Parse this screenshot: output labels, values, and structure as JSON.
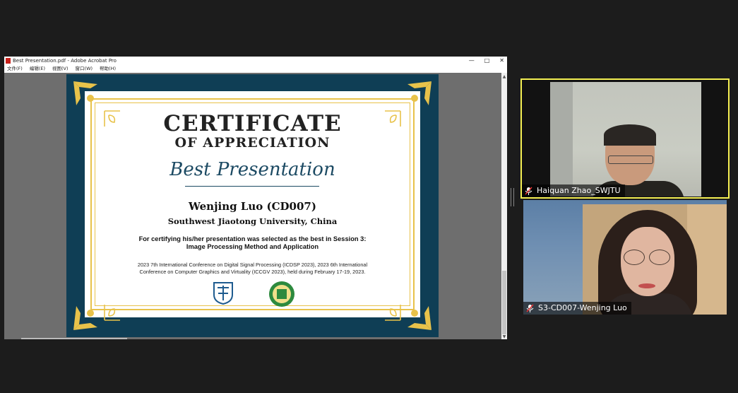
{
  "acrobat": {
    "window_title": "Best Presentation.pdf - Adobe Acrobat Pro",
    "window_buttons": [
      "—",
      "□",
      "✕"
    ],
    "menu": [
      "文件(F)",
      "编辑(E)",
      "视图(V)",
      "窗口(W)",
      "帮助(H)"
    ]
  },
  "certificate": {
    "heading": "CERTIFICATE",
    "subheading": "OF APPRECIATION",
    "award": "Best Presentation",
    "recipient": "Wenjing Luo (CD007)",
    "university": "Southwest Jiaotong University, China",
    "statement_line1": "For certifying his/her presentation was selected as the best in Session 3:",
    "statement_line2": "Image Processing Method and Application",
    "conference_line1": "2023 7th International Conference on Digital Signal Processing (ICDSP 2023), 2023 6th International",
    "conference_line2": "Conference on Computer Graphics and Virtuality (ICCGV 2023), held during February 17-19, 2023.",
    "colors": {
      "frame": "#0f3e55",
      "gold": "#e8c24a",
      "award": "#1c4a63"
    }
  },
  "participants": [
    {
      "name": "Haiquan Zhao_SWJTU",
      "active_speaker": true
    },
    {
      "name": "S3-CD007-Wenjing Luo",
      "active_speaker": false
    }
  ],
  "colors": {
    "speaker_highlight": "#f4ef52",
    "background": "#1c1c1c"
  }
}
